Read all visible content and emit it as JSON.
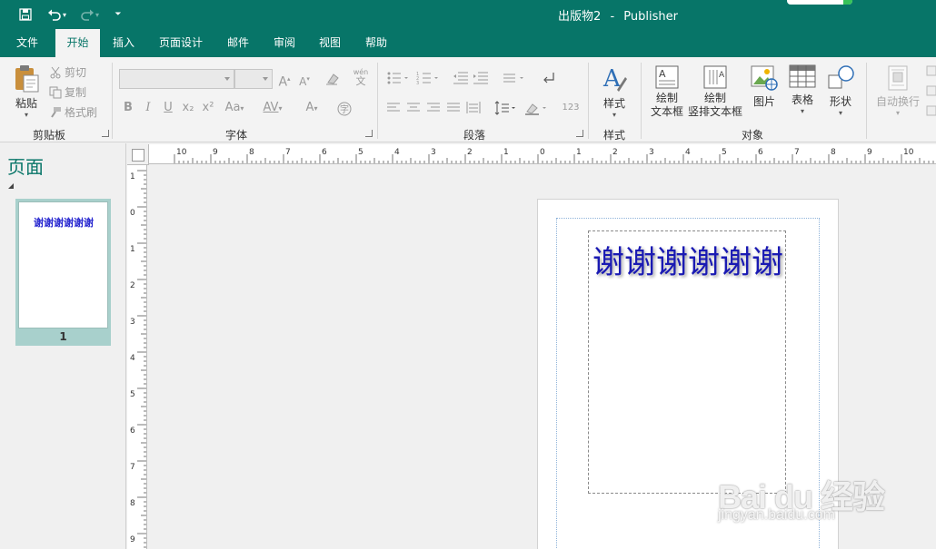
{
  "app": {
    "document_name": "出版物2",
    "separator": "-",
    "product": "Publisher",
    "accent_color": "#077568"
  },
  "quick_access": [
    {
      "name": "save-icon",
      "glyph": "🖫"
    },
    {
      "name": "undo-icon",
      "glyph": "↶"
    },
    {
      "name": "redo-icon",
      "glyph": "↷"
    },
    {
      "name": "customize-qat-icon",
      "glyph": "⏷"
    }
  ],
  "tabs": [
    {
      "label": "文件",
      "active": false
    },
    {
      "label": "开始",
      "active": true
    },
    {
      "label": "插入",
      "active": false
    },
    {
      "label": "页面设计",
      "active": false
    },
    {
      "label": "邮件",
      "active": false
    },
    {
      "label": "审阅",
      "active": false
    },
    {
      "label": "视图",
      "active": false
    },
    {
      "label": "帮助",
      "active": false
    }
  ],
  "ribbon": {
    "clipboard": {
      "label": "剪贴板",
      "paste": "粘贴",
      "cut": "剪切",
      "copy": "复制",
      "format_painter": "格式刷"
    },
    "font": {
      "label": "字体",
      "bold": "B",
      "italic": "I",
      "underline": "U",
      "subscript": "x₂",
      "superscript": "x²",
      "change_case": "Aa",
      "char_spacing": "AV",
      "font_color": "A",
      "grow": "A",
      "shrink": "A",
      "phonetic": "wén",
      "phonetic_char": "文"
    },
    "paragraph": {
      "label": "段落",
      "number": "123"
    },
    "styles": {
      "label": "样式",
      "button": "样式"
    },
    "objects": {
      "label": "对象",
      "draw_textbox_line1": "绘制",
      "draw_textbox_line2": "文本框",
      "draw_vtextbox_line1": "绘制",
      "draw_vtextbox_line2": "竖排文本框",
      "picture": "图片",
      "table": "表格",
      "shapes": "形状"
    },
    "wrap": {
      "button": "自动换行"
    }
  },
  "pages_pane": {
    "title": "页面",
    "thumbnails": [
      {
        "number": "1",
        "text": "谢谢谢谢谢谢"
      }
    ]
  },
  "rulers": {
    "horizontal_labels": [
      "10",
      "9",
      "8",
      "7",
      "6",
      "5",
      "4",
      "3",
      "2",
      "1",
      "0",
      "1",
      "2",
      "3",
      "4",
      "5",
      "6",
      "7",
      "8",
      "9",
      "10"
    ],
    "vertical_labels": [
      "1",
      "0",
      "1",
      "2",
      "3",
      "4",
      "5",
      "6",
      "7",
      "8",
      "9"
    ]
  },
  "document": {
    "textbox_text": "谢谢谢谢谢谢"
  },
  "watermark": {
    "main": "Bai du 经验",
    "sub": "jingyan.baidu.com"
  }
}
